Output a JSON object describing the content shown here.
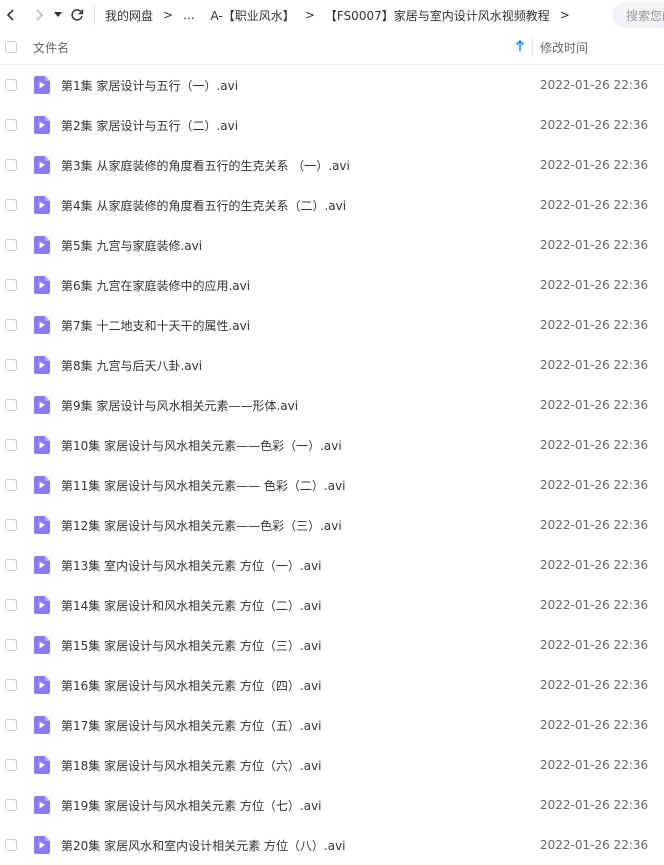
{
  "toolbar": {
    "breadcrumbs": [
      "我的网盘",
      "...",
      "A-【职业风水】",
      "【FS0007】家居与室内设计风水视频教程"
    ],
    "search_placeholder": "搜索您的文件"
  },
  "header": {
    "name_label": "文件名",
    "time_label": "修改时间"
  },
  "colors": {
    "accent": "#1a8cff",
    "file_icon": "#8c7bf0"
  },
  "files": [
    {
      "name": "第1集 家居设计与五行（一）.avi",
      "time": "2022-01-26 22:36"
    },
    {
      "name": "第2集 家居设计与五行（二）.avi",
      "time": "2022-01-26 22:36"
    },
    {
      "name": "第3集 从家庭装修的角度看五行的生克关系 （一）.avi",
      "time": "2022-01-26 22:36"
    },
    {
      "name": "第4集 从家庭装修的角度看五行的生克关系（二）.avi",
      "time": "2022-01-26 22:36"
    },
    {
      "name": "第5集 九宫与家庭装修.avi",
      "time": "2022-01-26 22:36"
    },
    {
      "name": "第6集 九宫在家庭装修中的应用.avi",
      "time": "2022-01-26 22:36"
    },
    {
      "name": "第7集 十二地支和十天干的属性.avi",
      "time": "2022-01-26 22:36"
    },
    {
      "name": "第8集 九宫与后天八卦.avi",
      "time": "2022-01-26 22:36"
    },
    {
      "name": "第9集 家居设计与风水相关元素——形体.avi",
      "time": "2022-01-26 22:36"
    },
    {
      "name": "第10集 家居设计与风水相关元素——色彩（一）.avi",
      "time": "2022-01-26 22:36"
    },
    {
      "name": "第11集 家居设计与风水相关元素—— 色彩（二）.avi",
      "time": "2022-01-26 22:36"
    },
    {
      "name": "第12集 家居设计与风水相关元素——色彩（三）.avi",
      "time": "2022-01-26 22:36"
    },
    {
      "name": "第13集 室内设计与风水相关元素 方位（一）.avi",
      "time": "2022-01-26 22:36"
    },
    {
      "name": "第14集 家居设计和风水相关元素 方位（二）.avi",
      "time": "2022-01-26 22:36"
    },
    {
      "name": "第15集 家居设计与风水相关元素 方位（三）.avi",
      "time": "2022-01-26 22:36"
    },
    {
      "name": "第16集 家居设计与风水相关元素 方位（四）.avi",
      "time": "2022-01-26 22:36"
    },
    {
      "name": "第17集 家居设计与风水相关元素 方位（五）.avi",
      "time": "2022-01-26 22:36"
    },
    {
      "name": "第18集 家居设计与风水相关元素 方位（六）.avi",
      "time": "2022-01-26 22:36"
    },
    {
      "name": "第19集 家居设计与风水相关元素 方位（七）.avi",
      "time": "2022-01-26 22:36"
    },
    {
      "name": "第20集 家居风水和室内设计相关元素 方位（八）.avi",
      "time": "2022-01-26 22:36"
    }
  ]
}
